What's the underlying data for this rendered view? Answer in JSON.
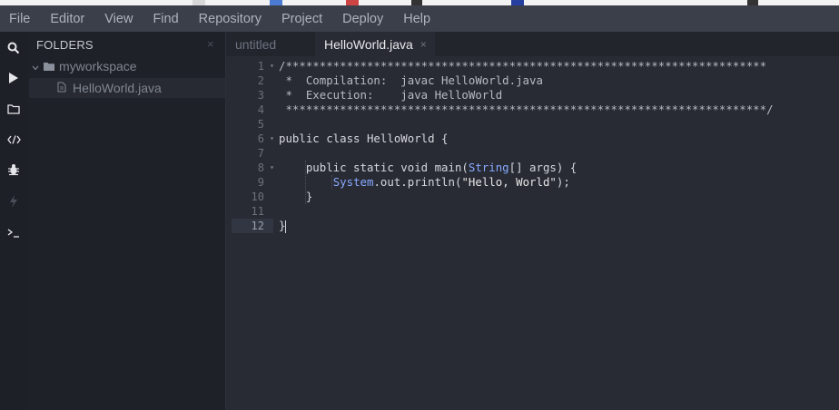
{
  "menu": [
    "File",
    "Editor",
    "View",
    "Find",
    "Repository",
    "Project",
    "Deploy",
    "Help"
  ],
  "sidebar": {
    "header": "FOLDERS",
    "close": "×",
    "tree": [
      {
        "label": "myworkspace",
        "type": "folder"
      },
      {
        "label": "HelloWorld.java",
        "type": "file"
      }
    ]
  },
  "tabs": [
    {
      "label": "untitled",
      "active": false
    },
    {
      "label": "HelloWorld.java",
      "active": true,
      "close": "×"
    }
  ],
  "editor": {
    "line_numbers": [
      "1",
      "2",
      "3",
      "4",
      "5",
      "6",
      "7",
      "8",
      "9",
      "10",
      "11",
      "12"
    ],
    "current_line": 12,
    "lines": [
      "/***********************************************************************",
      " *  Compilation:  javac HelloWorld.java",
      " *  Execution:    java HelloWorld",
      " ***********************************************************************/",
      "",
      "public class HelloWorld {",
      "",
      "    public static void main(String[] args) {",
      "        System.out.println(\"Hello, World\");",
      "    }",
      "",
      "}"
    ]
  },
  "icons": {
    "activity": [
      "search-icon",
      "run-icon",
      "folder-icon",
      "code-icon",
      "bug-icon",
      "bolt-icon",
      "terminal-icon"
    ]
  },
  "colors": {
    "background": "#272a33",
    "menubar": "#3b3f4a",
    "sidebar": "#1f2128",
    "type_highlight": "#89a9ff"
  }
}
